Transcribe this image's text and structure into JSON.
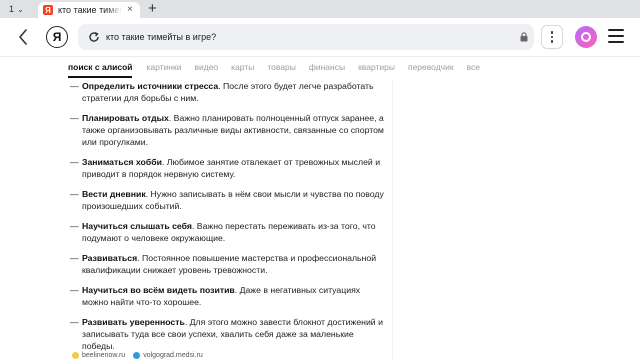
{
  "tabs": {
    "counter": "1",
    "active_title": "кто такие тимеm",
    "new_tab": "+"
  },
  "toolbar": {
    "logo_letter": "Я",
    "favicon_letter": "Я",
    "url": "кто такие тимейты в игре?"
  },
  "search_nav": {
    "items": [
      "поиск с алисой",
      "картинки",
      "видео",
      "карты",
      "товары",
      "финансы",
      "квартиры",
      "переводчик",
      "все"
    ]
  },
  "list": [
    {
      "bold": "Определить источники стресса",
      "text": ". После этого будет легче разработать стратегии для борьбы с ним."
    },
    {
      "bold": "Планировать отдых",
      "text": ". Важно планировать полноценный отпуск заранее, а также организовывать различные виды активности, связанные со спортом или прогулками."
    },
    {
      "bold": "Заниматься хобби",
      "text": ". Любимое занятие отвлекает от тревожных мыслей и приводит в порядок нервную систему."
    },
    {
      "bold": "Вести дневник",
      "text": ". Нужно записывать в нём свои мысли и чувства по поводу произошедших событий."
    },
    {
      "bold": "Научиться слышать себя",
      "text": ". Важно перестать переживать из-за того, что подумают о человеке окружающие."
    },
    {
      "bold": "Развиваться",
      "text": ". Постоянное повышение мастерства и профессиональной квалификации снижает уровень тревожности."
    },
    {
      "bold": "Научиться во всём видеть позитив",
      "text": ". Даже в негативных ситуациях можно найти что-то хорошее."
    },
    {
      "bold": "Развивать уверенность",
      "text": ". Для этого можно завести блокнот достижений и записывать туда все свои успехи, хвалить себя даже за маленькие победы."
    }
  ],
  "sources": [
    {
      "label": "beelinenow.ru",
      "color": "#f2c94c"
    },
    {
      "label": "volgograd.medsi.ru",
      "color": "#2d9cdb"
    }
  ]
}
